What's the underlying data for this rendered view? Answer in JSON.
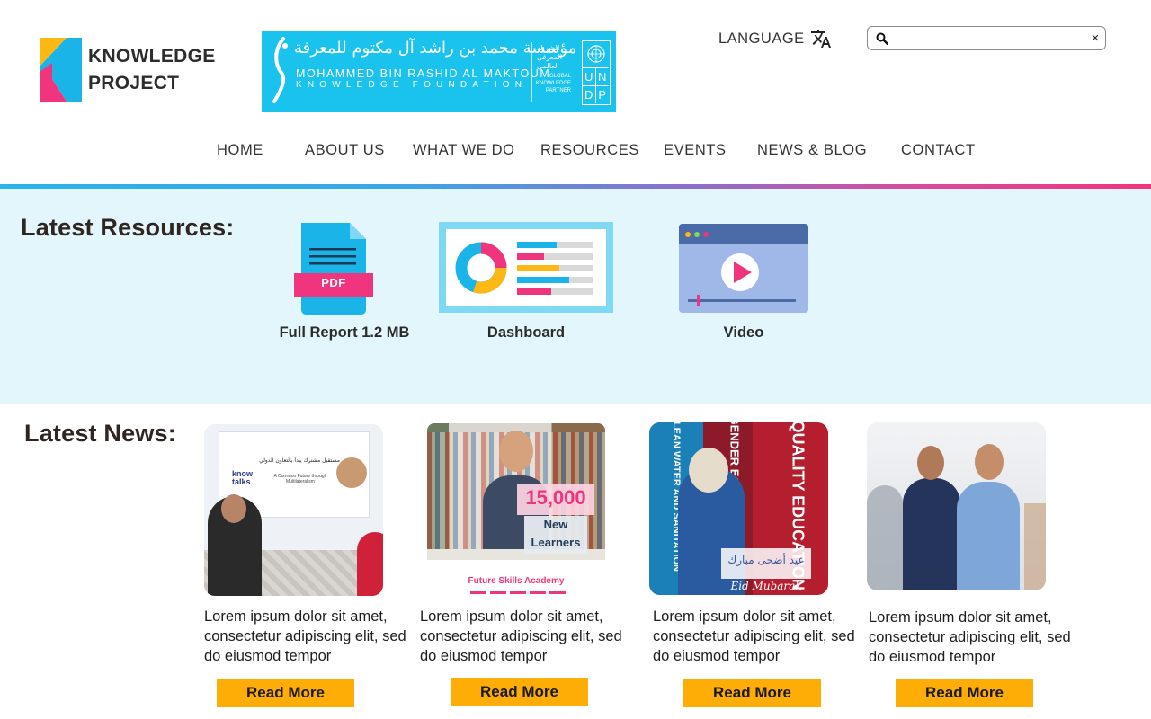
{
  "brand": {
    "line1": "KNOWLEDGE",
    "line2": "PROJECT",
    "colors": {
      "orange": "#fdb813",
      "cyan": "#1ab4e8",
      "magenta": "#f0357e"
    }
  },
  "partner": {
    "arabic_name": "مؤسسة محمد بن راشد آل مكتوم للمعرفة",
    "english_line1": "MOHAMMED BIN RASHID AL MAKTOUM",
    "english_line2": "KNOWLEDGE FOUNDATION",
    "partner_ar": "الشريك المعرفي العالمي",
    "partner_en": "GLOBAL KNOWLEDGE PARTNER",
    "undp": [
      "U",
      "N",
      "D",
      "P"
    ]
  },
  "header": {
    "language_label": "LANGUAGE",
    "search_placeholder": "",
    "clear_glyph": "×"
  },
  "nav": {
    "items": [
      "HOME",
      "ABOUT US",
      "WHAT WE DO",
      "RESOURCES",
      "EVENTS",
      "NEWS & BLOG",
      "CONTACT"
    ]
  },
  "resources": {
    "title": "Latest Resources:",
    "pdf_badge": "PDF",
    "items": [
      {
        "label": "Full Report 1.2 MB",
        "icon": "pdf-file-icon"
      },
      {
        "label": "Dashboard",
        "icon": "dashboard-icon"
      },
      {
        "label": "Video",
        "icon": "video-player-icon"
      }
    ]
  },
  "news": {
    "title": "Latest News:",
    "read_more": "Read More",
    "cards": [
      {
        "image": "know-talks-event-photo",
        "text": "Lorem ipsum dolor sit amet, consectetur adipiscing elit, sed do eiusmod tempor",
        "overlay_ar": "مستقبل مشترك يبدأ بالتعاون الدولي",
        "overlay_en": "A Common Future through Multilateralism",
        "badge": "know talks"
      },
      {
        "image": "future-skills-student-photo",
        "text": "Lorem ipsum dolor sit amet, consectetur adipiscing elit, sed do eiusmod tempor",
        "stat": "15,000",
        "stat_line1": "New",
        "stat_line2": "Learners",
        "caption": "Future Skills Academy"
      },
      {
        "image": "eid-mubarak-photo",
        "text": "Lorem ipsum dolor sit amet, consectetur adipiscing elit, sed do eiusmod tempor",
        "eid_ar": "عيد أضحى مبارك",
        "eid_en": "Eid Mubarak",
        "wall_text": "QUALITY EDUCATION",
        "wall_text2": "GENDER EQUALITY",
        "wall_text3": "CLEAN WATER AND SANITATION"
      },
      {
        "image": "team-photo",
        "text": "Lorem ipsum dolor sit amet, consectetur adipiscing elit, sed do eiusmod tempor"
      }
    ]
  },
  "colors": {
    "resources_bg": "#e2f6fb",
    "read_more_bg": "#fdad06",
    "pdf_blue": "#1ab4e8",
    "pdf_pink": "#f0357e"
  }
}
